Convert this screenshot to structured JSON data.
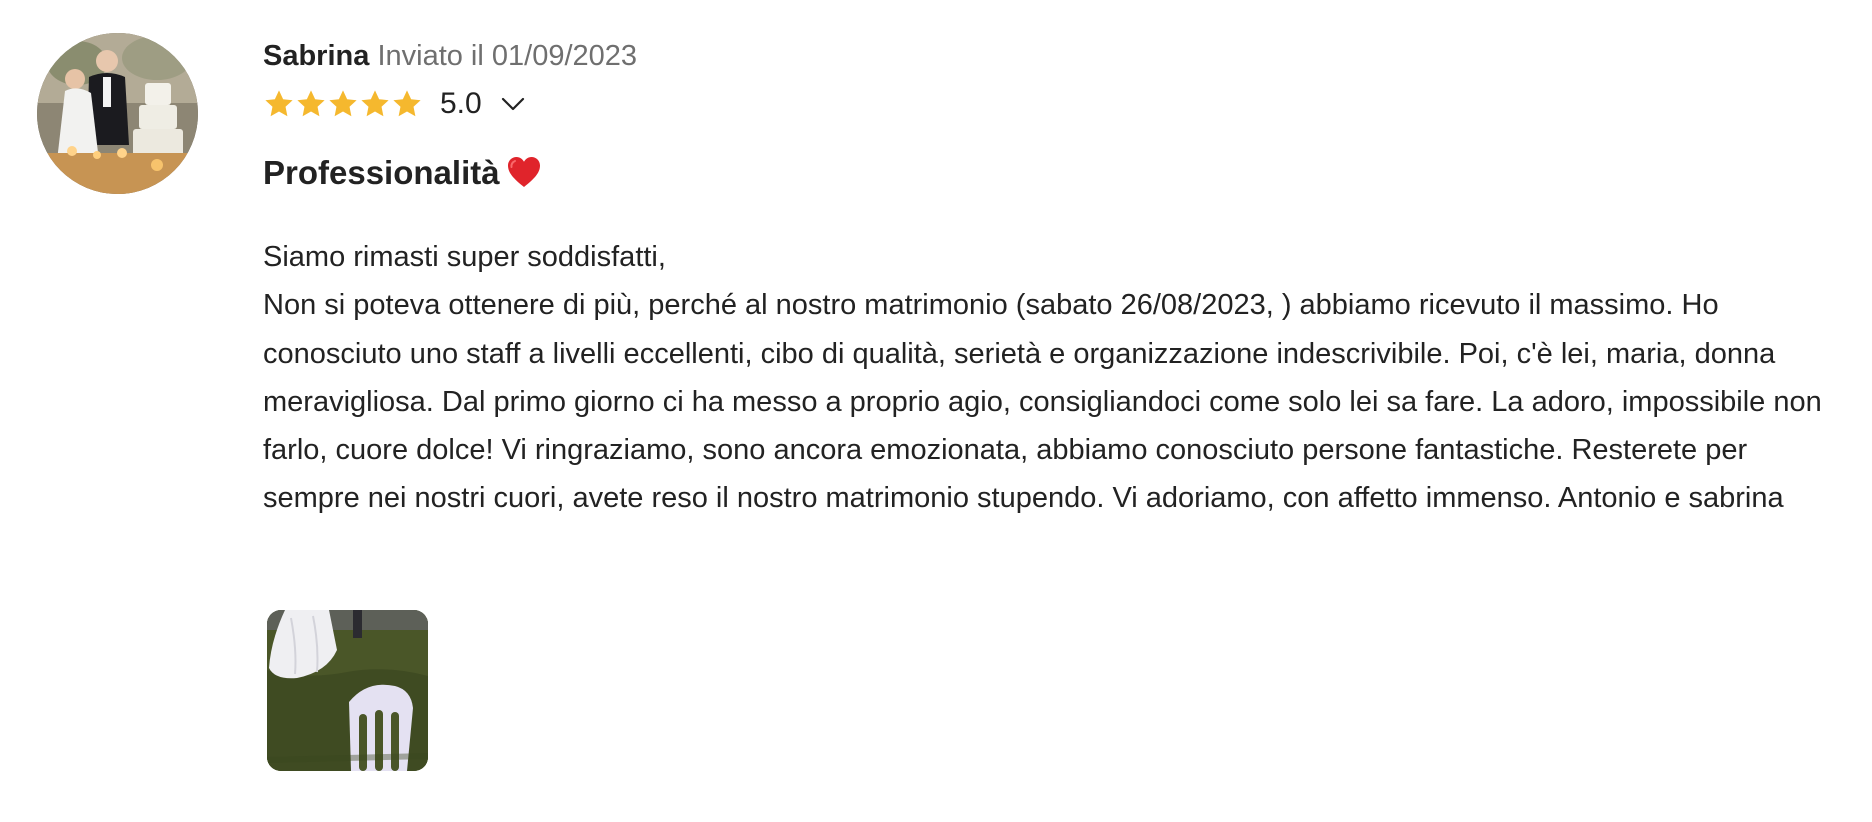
{
  "review": {
    "author": "Sabrina",
    "sent_label": "Inviato il 01/09/2023",
    "rating": "5.0",
    "star_count": 5,
    "star_color": "#f5b82e",
    "title": "Professionalità",
    "title_emoji": "heart-icon",
    "body_lines": [
      "Siamo rimasti super soddisfatti,",
      "Non si poteva ottenere di più, perché al nostro matrimonio (sabato 26/08/2023, ) abbiamo ricevuto il massimo. Ho conosciuto uno staff a livelli eccellenti, cibo di qualità, serietà e organizzazione indescrivibile. Poi, c'è lei, maria, donna meravigliosa. Dal primo giorno ci ha messo a proprio agio, consigliandoci come solo lei sa fare. La adoro, impossibile non farlo, cuore dolce! Vi ringraziamo, sono ancora emozionata, abbiamo conosciuto persone fantastiche. Resterete per sempre nei nostri cuori, avete reso il nostro matrimonio stupendo. Vi adoriamo, con affetto immenso. Antonio e sabrina"
    ]
  }
}
